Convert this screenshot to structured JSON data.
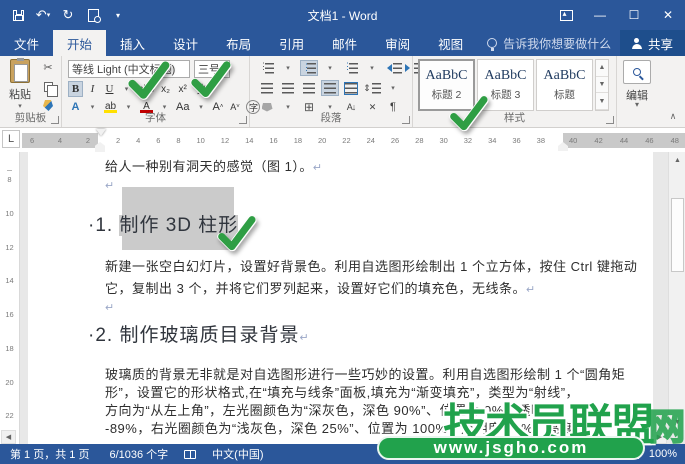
{
  "title_bar": {
    "title": "文档1 - Word"
  },
  "tabs": {
    "file": "文件",
    "home": "开始",
    "insert": "插入",
    "design": "设计",
    "layout": "布局",
    "references": "引用",
    "mailings": "邮件",
    "review": "审阅",
    "view": "视图"
  },
  "tell_me": "告诉我你想要做什么",
  "share_label": "共享",
  "ribbon": {
    "clipboard": {
      "paste": "粘贴",
      "label": "剪贴板"
    },
    "font": {
      "name": "等线 Light (中文标题)",
      "size": "三号",
      "label": "字体",
      "bold": "B",
      "italic": "I",
      "underline": "U",
      "strike": "abc",
      "subscript": "x₂",
      "superscript": "x²",
      "phonetic": "文",
      "char_border": "A",
      "text_effects": "A",
      "highlight": "ab",
      "font_color": "A",
      "change_case": "Aa",
      "grow": "A",
      "shrink": "A",
      "enclose": "字"
    },
    "paragraph": {
      "label": "段落"
    },
    "styles": {
      "label": "样式",
      "items": [
        {
          "preview": "AaBbC",
          "name": "标题 2"
        },
        {
          "preview": "AaBbC",
          "name": "标题 3"
        },
        {
          "preview": "AaBbC",
          "name": "标题"
        }
      ]
    },
    "editing": {
      "label": "编辑"
    }
  },
  "ruler": {
    "tab_selector": "L",
    "left_numbers": [
      "6",
      "4",
      "2"
    ],
    "mid_numbers": [
      "2",
      "4",
      "6",
      "8",
      "10",
      "12",
      "14",
      "16",
      "18",
      "20",
      "22",
      "24",
      "26",
      "28",
      "30",
      "32",
      "34",
      "36",
      "38"
    ],
    "right_numbers": [
      "40",
      "42",
      "44",
      "46",
      "48"
    ],
    "v_numbers": [
      "8",
      "10",
      "12",
      "14",
      "16",
      "18",
      "20",
      "22"
    ]
  },
  "document": {
    "pilcrow": "↵",
    "p1": "给人一种别有洞天的感觉（图 1）。",
    "h1_prefix": "·1. ",
    "h1_selected": "制作 3D 柱形",
    "p2_l1": "新建一张空白幻灯片，设置好背景色。利用自选图形绘制出 1 个立方体，按住 Ctrl 键拖动",
    "p2_l2": "它，复制出 3 个，并将它们罗列起来，设置好它们的填充色，无线条。",
    "h2": "·2. 制作玻璃质目录背景",
    "p3_l1": "玻璃质的背景无非就是对自选图形进行一些巧妙的设置。利用自选图形绘制 1 个“圆角矩",
    "p3_l2": "形”，设置它的形状格式,在“填充与线条”面板,填充为“渐变填充”，类型为“射线”，",
    "p3_l3": "方向为“从左上角”，左光圈颜色为“深灰色，深色 90%”、位置为 0%、透明度",
    "p3_l4": "-89%，右光圈颜色为“浅灰色，深色 25%”、位置为 100%、透明度 78%、亮度"
  },
  "watermark": {
    "text": "技术员联盟",
    "suffix": "网",
    "url": "www.jsgho.com",
    "color": "#21a24c"
  },
  "status_bar": {
    "page": "第 1 页，共 1 页",
    "words": "6/1036 个字",
    "language": "中文(中国)",
    "zoom": "100%"
  }
}
